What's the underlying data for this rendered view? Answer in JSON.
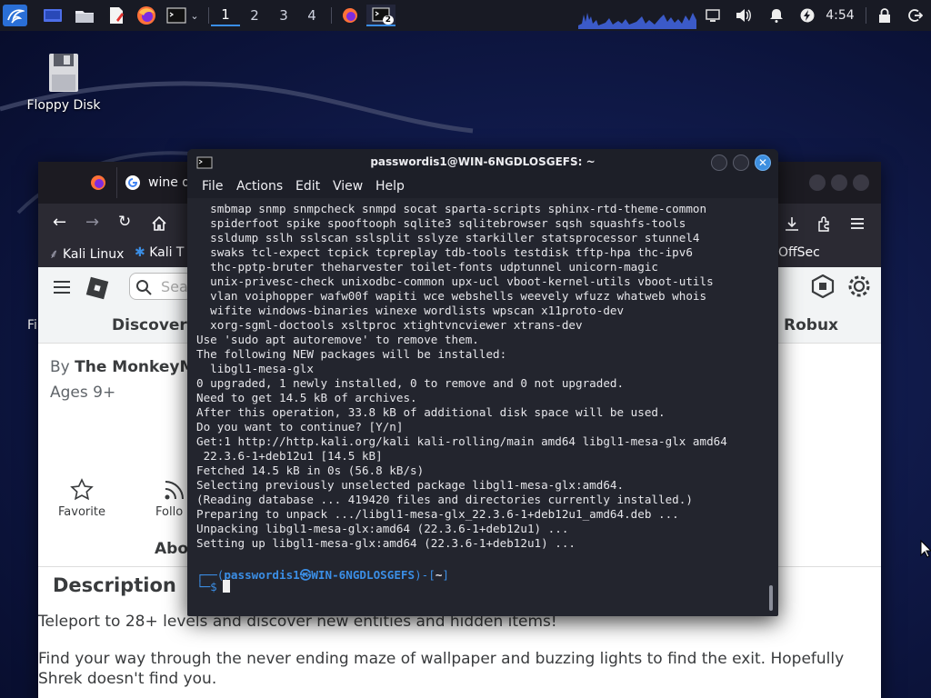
{
  "panel": {
    "workspaces": [
      "1",
      "2",
      "3",
      "4"
    ],
    "active_workspace": "1",
    "task_badge": "2",
    "clock": "4:54"
  },
  "desktop": {
    "floppy_label": "Floppy Disk",
    "partial_label": "Fi"
  },
  "browser": {
    "tab2_title": "wine de",
    "bookmarks": {
      "kali_linux": "Kali Linux",
      "kali_t": "Kali T",
      "offsec": "OffSec"
    },
    "search_placeholder": "Sea",
    "nav_discover": "Discover",
    "nav_robux": "Robux",
    "by_label": "By",
    "creator": "The MonkeyMa",
    "ages": "Ages 9+",
    "favorite_label": "Favorite",
    "follow_label": "Follo",
    "about_tab": "Abo",
    "description_heading": "Description",
    "description_line1": "Teleport to 28+ levels and discover new entities and hidden items!",
    "description_line2": "Find your way through the never ending maze of wallpaper and buzzing lights to find the exit. Hopefully Shrek doesn't find you."
  },
  "terminal": {
    "title": "passwordis1@WIN-6NGDLOSGEFS: ~",
    "menu": [
      "File",
      "Actions",
      "Edit",
      "View",
      "Help"
    ],
    "output": "  smbmap snmp snmpcheck snmpd socat sparta-scripts sphinx-rtd-theme-common\n  spiderfoot spike spooftooph sqlite3 sqlitebrowser sqsh squashfs-tools\n  ssldump sslh sslscan sslsplit sslyze starkiller statsprocessor stunnel4\n  swaks tcl-expect tcpick tcpreplay tdb-tools testdisk tftp-hpa thc-ipv6\n  thc-pptp-bruter theharvester toilet-fonts udptunnel unicorn-magic\n  unix-privesc-check unixodbc-common upx-ucl vboot-kernel-utils vboot-utils\n  vlan voiphopper wafw00f wapiti wce webshells weevely wfuzz whatweb whois\n  wifite windows-binaries winexe wordlists wpscan x11proto-dev\n  xorg-sgml-doctools xsltproc xtightvncviewer xtrans-dev\nUse 'sudo apt autoremove' to remove them.\nThe following NEW packages will be installed:\n  libgl1-mesa-glx\n0 upgraded, 1 newly installed, 0 to remove and 0 not upgraded.\nNeed to get 14.5 kB of archives.\nAfter this operation, 33.8 kB of additional disk space will be used.\nDo you want to continue? [Y/n]\nGet:1 http://http.kali.org/kali kali-rolling/main amd64 libgl1-mesa-glx amd64\n 22.3.6-1+deb12u1 [14.5 kB]\nFetched 14.5 kB in 0s (56.8 kB/s)\nSelecting previously unselected package libgl1-mesa-glx:amd64.\n(Reading database ... 419420 files and directories currently installed.)\nPreparing to unpack .../libgl1-mesa-glx_22.3.6-1+deb12u1_amd64.deb ...\nUnpacking libgl1-mesa-glx:amd64 (22.3.6-1+deb12u1) ...\nSetting up libgl1-mesa-glx:amd64 (22.3.6-1+deb12u1) ...",
    "prompt_open": "┌──(",
    "prompt_user": "passwordis1",
    "prompt_at": "㉿",
    "prompt_host": "WIN-6NGDLOSGEFS",
    "prompt_mid": ")-[",
    "prompt_dir": "~",
    "prompt_close": "]",
    "prompt_line2": "└─$"
  },
  "colors": {
    "panel_bg": "#181a24",
    "accent": "#3b8ee5",
    "terminal_bg": "#23252e"
  }
}
